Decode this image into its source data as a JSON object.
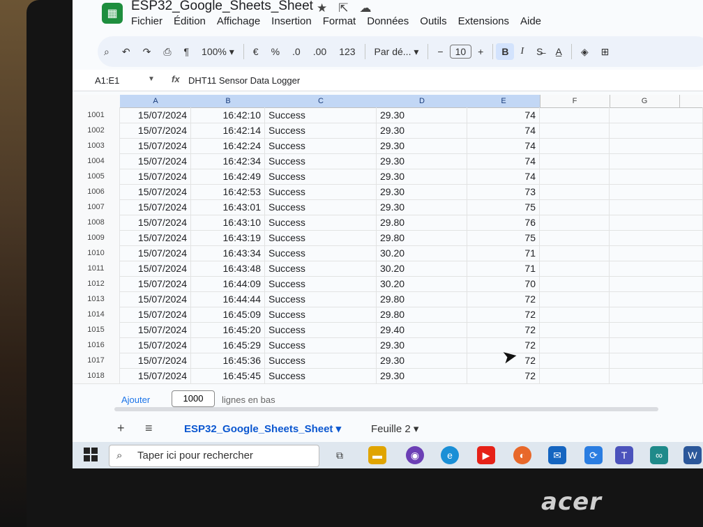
{
  "app": {
    "title": "ESP32_Google_Sheets_Sheet",
    "menu": [
      "Fichier",
      "Édition",
      "Affichage",
      "Insertion",
      "Format",
      "Données",
      "Outils",
      "Extensions",
      "Aide"
    ]
  },
  "toolbar": {
    "zoom": "100%",
    "currency": "€",
    "percent": "%",
    "dec_decrease": ".0",
    "dec_increase": ".00",
    "number_format": "123",
    "font": "Par dé...",
    "font_size": "10",
    "minus": "−",
    "plus": "+",
    "bold": "B",
    "italic": "I"
  },
  "formula_bar": {
    "name_box": "A1:E1",
    "fx": "fx",
    "formula": "DHT11 Sensor Data Logger"
  },
  "columns": [
    "A",
    "B",
    "C",
    "D",
    "E",
    "F",
    "G"
  ],
  "rows": [
    {
      "n": "1001",
      "a": "15/07/2024",
      "b": "16:42:10",
      "c": "Success",
      "d": "29.30",
      "e": "74"
    },
    {
      "n": "1002",
      "a": "15/07/2024",
      "b": "16:42:14",
      "c": "Success",
      "d": "29.30",
      "e": "74"
    },
    {
      "n": "1003",
      "a": "15/07/2024",
      "b": "16:42:24",
      "c": "Success",
      "d": "29.30",
      "e": "74"
    },
    {
      "n": "1004",
      "a": "15/07/2024",
      "b": "16:42:34",
      "c": "Success",
      "d": "29.30",
      "e": "74"
    },
    {
      "n": "1005",
      "a": "15/07/2024",
      "b": "16:42:49",
      "c": "Success",
      "d": "29.30",
      "e": "74"
    },
    {
      "n": "1006",
      "a": "15/07/2024",
      "b": "16:42:53",
      "c": "Success",
      "d": "29.30",
      "e": "73"
    },
    {
      "n": "1007",
      "a": "15/07/2024",
      "b": "16:43:01",
      "c": "Success",
      "d": "29.30",
      "e": "75"
    },
    {
      "n": "1008",
      "a": "15/07/2024",
      "b": "16:43:10",
      "c": "Success",
      "d": "29.80",
      "e": "76"
    },
    {
      "n": "1009",
      "a": "15/07/2024",
      "b": "16:43:19",
      "c": "Success",
      "d": "29.80",
      "e": "75"
    },
    {
      "n": "1010",
      "a": "15/07/2024",
      "b": "16:43:34",
      "c": "Success",
      "d": "30.20",
      "e": "71"
    },
    {
      "n": "1011",
      "a": "15/07/2024",
      "b": "16:43:48",
      "c": "Success",
      "d": "30.20",
      "e": "71"
    },
    {
      "n": "1012",
      "a": "15/07/2024",
      "b": "16:44:09",
      "c": "Success",
      "d": "30.20",
      "e": "70"
    },
    {
      "n": "1013",
      "a": "15/07/2024",
      "b": "16:44:44",
      "c": "Success",
      "d": "29.80",
      "e": "72"
    },
    {
      "n": "1014",
      "a": "15/07/2024",
      "b": "16:45:09",
      "c": "Success",
      "d": "29.80",
      "e": "72"
    },
    {
      "n": "1015",
      "a": "15/07/2024",
      "b": "16:45:20",
      "c": "Success",
      "d": "29.40",
      "e": "72"
    },
    {
      "n": "1016",
      "a": "15/07/2024",
      "b": "16:45:29",
      "c": "Success",
      "d": "29.30",
      "e": "72"
    },
    {
      "n": "1017",
      "a": "15/07/2024",
      "b": "16:45:36",
      "c": "Success",
      "d": "29.30",
      "e": "72"
    },
    {
      "n": "1018",
      "a": "15/07/2024",
      "b": "16:45:45",
      "c": "Success",
      "d": "29.30",
      "e": "72"
    }
  ],
  "footer": {
    "add_label": "Ajouter",
    "add_count": "1000",
    "add_suffix": "lignes en bas"
  },
  "sheet_tabs": [
    "ESP32_Google_Sheets_Sheet",
    "Feuille 2"
  ],
  "taskbar": {
    "search_placeholder": "Taper ici pour rechercher"
  },
  "brand": "acer",
  "colors": {
    "accent": "#0b57d0",
    "selected_header": "#c2d7f5",
    "toolbar_bg": "#edf2fa"
  }
}
